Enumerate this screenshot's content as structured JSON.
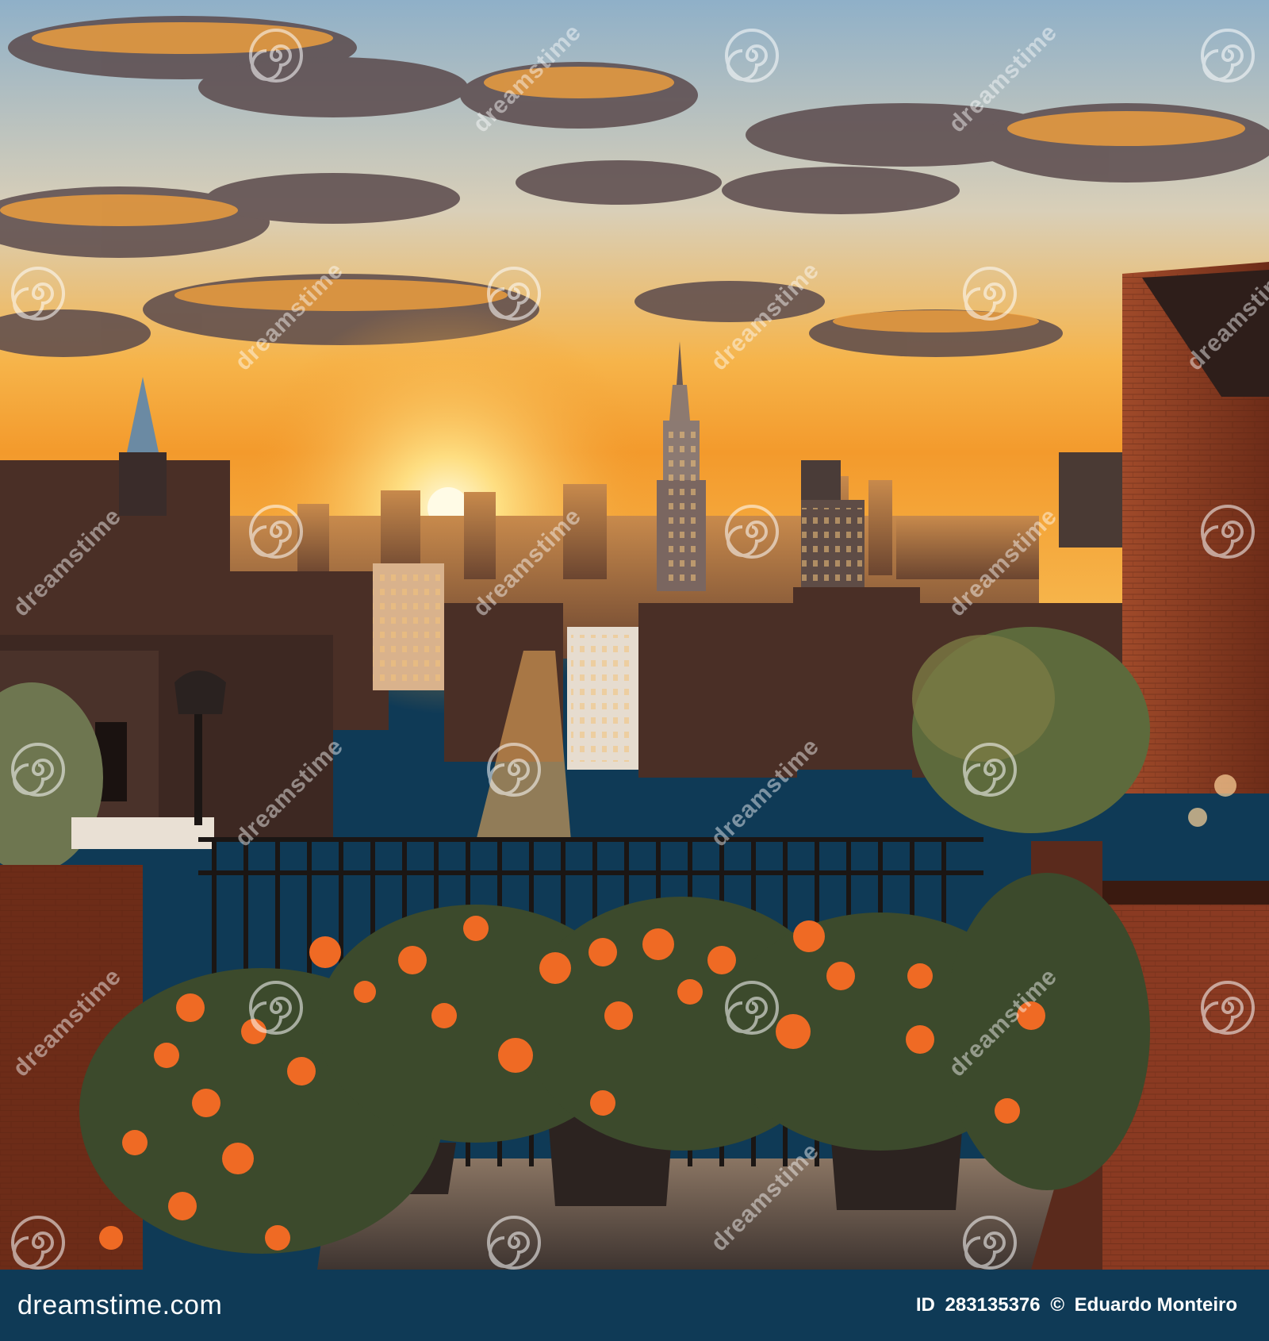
{
  "watermark": {
    "brand_text": "dreamstime",
    "logo_icon": "dreamstime-spiral-icon",
    "color": "#ffffff"
  },
  "footer": {
    "site": "dreamstime.com",
    "id_label": "ID",
    "id_value": "283135376",
    "copyright_symbol": "©",
    "author": "Eduardo Monteiro",
    "background": "#0f3a56"
  },
  "colors": {
    "sky_top": "#8fb3cf",
    "sky_horizon": "#f6b44a",
    "sun": "#fff2b0",
    "brick": "#8a3a22",
    "flowers": "#ef6a24"
  }
}
